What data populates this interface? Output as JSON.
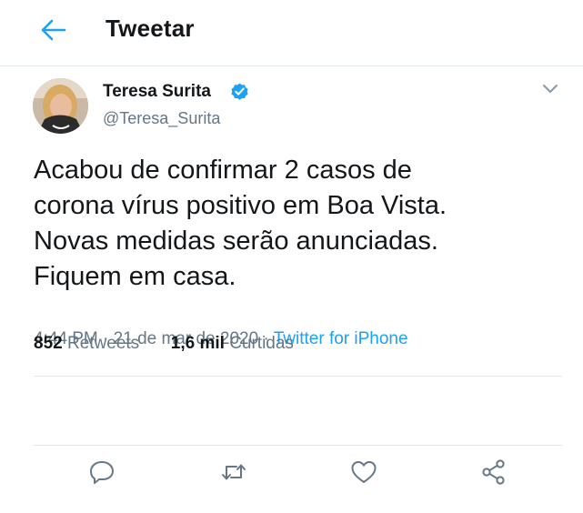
{
  "header": {
    "title": "Tweetar",
    "back_icon": "arrow-left-icon"
  },
  "tweet": {
    "author_name": "Teresa Surita",
    "handle": "@Teresa_Surita",
    "verified": true,
    "text": "Acabou de confirmar 2 casos de\ncorona vírus positivo em Boa Vista.\nNovas medidas serão anunciadas.\nFiquem em casa.",
    "time": "4:44 PM",
    "date": "21 de mar de 2020",
    "separator": "·",
    "source": "Twitter for iPhone",
    "retweets_count": "852",
    "retweets_label": "Retweets",
    "likes_count": "1,6 mil",
    "likes_label": "Curtidas"
  },
  "actions": [
    "reply-icon",
    "retweet-icon",
    "like-icon",
    "share-icon"
  ],
  "colors": {
    "accent": "#1da1f2",
    "text": "#14171a",
    "secondary": "#657786",
    "divider": "#e1e8ed"
  }
}
